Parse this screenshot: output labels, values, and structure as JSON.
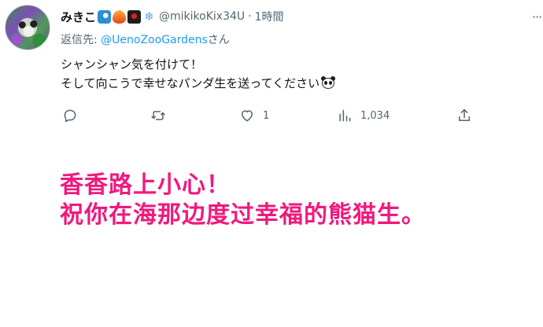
{
  "tweet": {
    "display_name": "みきこ",
    "name_emojis": [
      "wave-icon",
      "fire-icon",
      "sign-icon",
      "snow-icon"
    ],
    "snowflake_glyph": "❄",
    "handle": "@mikikoKix34U",
    "separator": "·",
    "time": "1時間",
    "more_glyph": "···",
    "reply_prefix": "返信先: ",
    "reply_mention": "@UenoZooGardens",
    "reply_suffix": "さん",
    "text_line1": "シャンシャン気を付けて！",
    "text_line2": "そして向こうで幸せなパンダ生を送ってください",
    "text_emoji": "panda-icon",
    "actions": {
      "reply_count": "",
      "retweet_count": "",
      "like_count": "1",
      "views_count": "1,034"
    },
    "icons": {
      "reply": "reply-icon",
      "retweet": "retweet-icon",
      "like": "heart-icon",
      "views": "views-icon",
      "share": "share-icon"
    }
  },
  "caption": {
    "line1": "香香路上小心！",
    "line2": "祝你在海那边度过幸福的熊猫生。",
    "color": "#f0197d"
  },
  "colors": {
    "link": "#1d9bf0",
    "muted": "#536471",
    "text": "#0f1419"
  }
}
